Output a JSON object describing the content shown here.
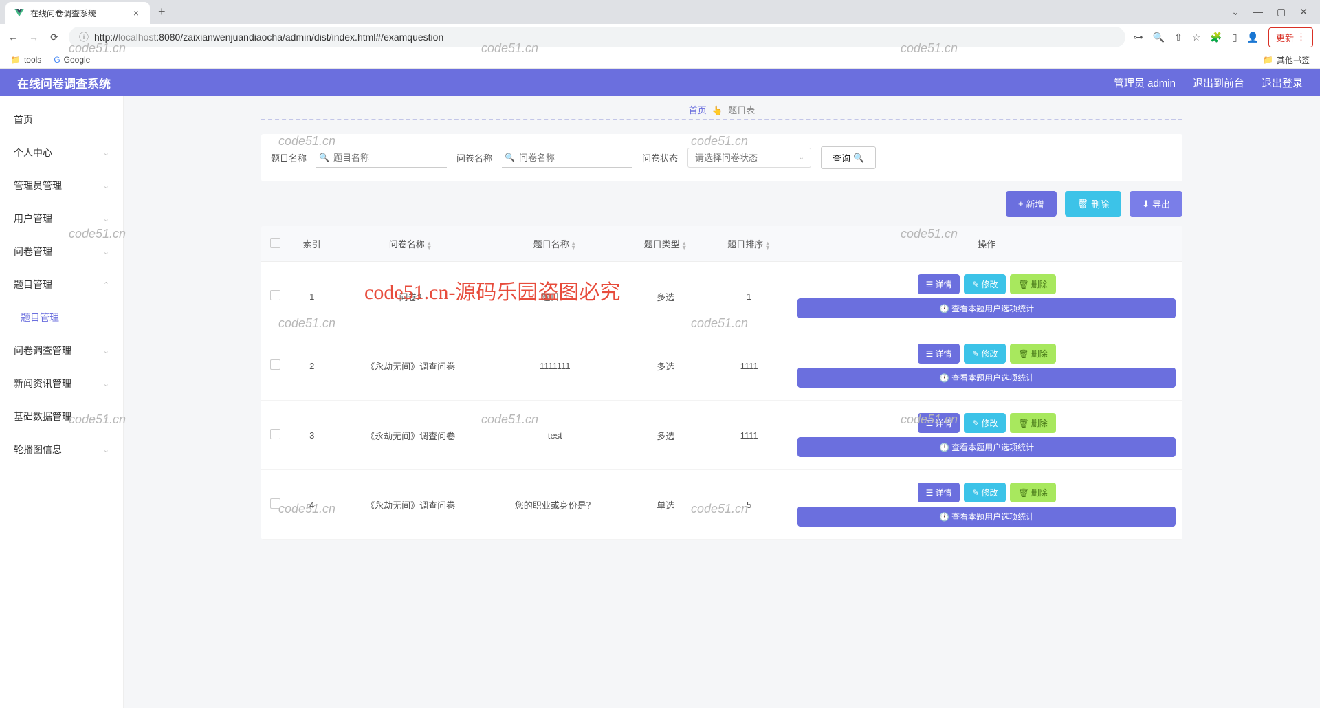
{
  "browser": {
    "tab_title": "在线问卷调查系统",
    "url_host": "localhost",
    "url_port": ":8080",
    "url_path": "/zaixianwenjuandiaocha/admin/dist/index.html#/examquestion",
    "update_label": "更新",
    "bookmarks": {
      "tools": "tools",
      "google": "Google",
      "other": "其他书签"
    }
  },
  "appHeader": {
    "title": "在线问卷调查系统",
    "admin": "管理员 admin",
    "back_front": "退出到前台",
    "logout": "退出登录"
  },
  "sidebar": [
    {
      "label": "首页",
      "expandable": false
    },
    {
      "label": "个人中心",
      "expandable": true
    },
    {
      "label": "管理员管理",
      "expandable": true
    },
    {
      "label": "用户管理",
      "expandable": true
    },
    {
      "label": "问卷管理",
      "expandable": true
    },
    {
      "label": "题目管理",
      "expandable": true,
      "open": true,
      "children": [
        {
          "label": "题目管理"
        }
      ]
    },
    {
      "label": "问卷调查管理",
      "expandable": true
    },
    {
      "label": "新闻资讯管理",
      "expandable": true
    },
    {
      "label": "基础数据管理",
      "expandable": true
    },
    {
      "label": "轮播图信息",
      "expandable": true
    }
  ],
  "breadcrumb": {
    "home": "首页",
    "current": "题目表"
  },
  "filters": {
    "q_name_label": "题目名称",
    "q_name_placeholder": "题目名称",
    "s_name_label": "问卷名称",
    "s_name_placeholder": "问卷名称",
    "status_label": "问卷状态",
    "status_placeholder": "请选择问卷状态",
    "query_btn": "查询"
  },
  "actions": {
    "add": "新增",
    "delete": "删除",
    "export": "导出"
  },
  "table": {
    "headers": {
      "idx": "索引",
      "survey": "问卷名称",
      "qname": "题目名称",
      "qtype": "题目类型",
      "qorder": "题目排序",
      "ops": "操作"
    },
    "ops": {
      "detail": "详情",
      "edit": "修改",
      "delete": "删除",
      "stat": "查看本题用户选项统计"
    },
    "rows": [
      {
        "idx": "1",
        "survey": "问卷2",
        "qname": "题目11",
        "qtype": "多选",
        "qorder": "1"
      },
      {
        "idx": "2",
        "survey": "《永劫无间》调查问卷",
        "qname": "1111111",
        "qtype": "多选",
        "qorder": "1111"
      },
      {
        "idx": "3",
        "survey": "《永劫无间》调查问卷",
        "qname": "test",
        "qtype": "多选",
        "qorder": "1111"
      },
      {
        "idx": "4",
        "survey": "《永劫无间》调查问卷",
        "qname": "您的职业或身份是？",
        "qtype": "单选",
        "qorder": "5"
      }
    ]
  },
  "watermarks": {
    "text": "code51.cn",
    "red": "code51.cn-源码乐园盗图必究"
  }
}
